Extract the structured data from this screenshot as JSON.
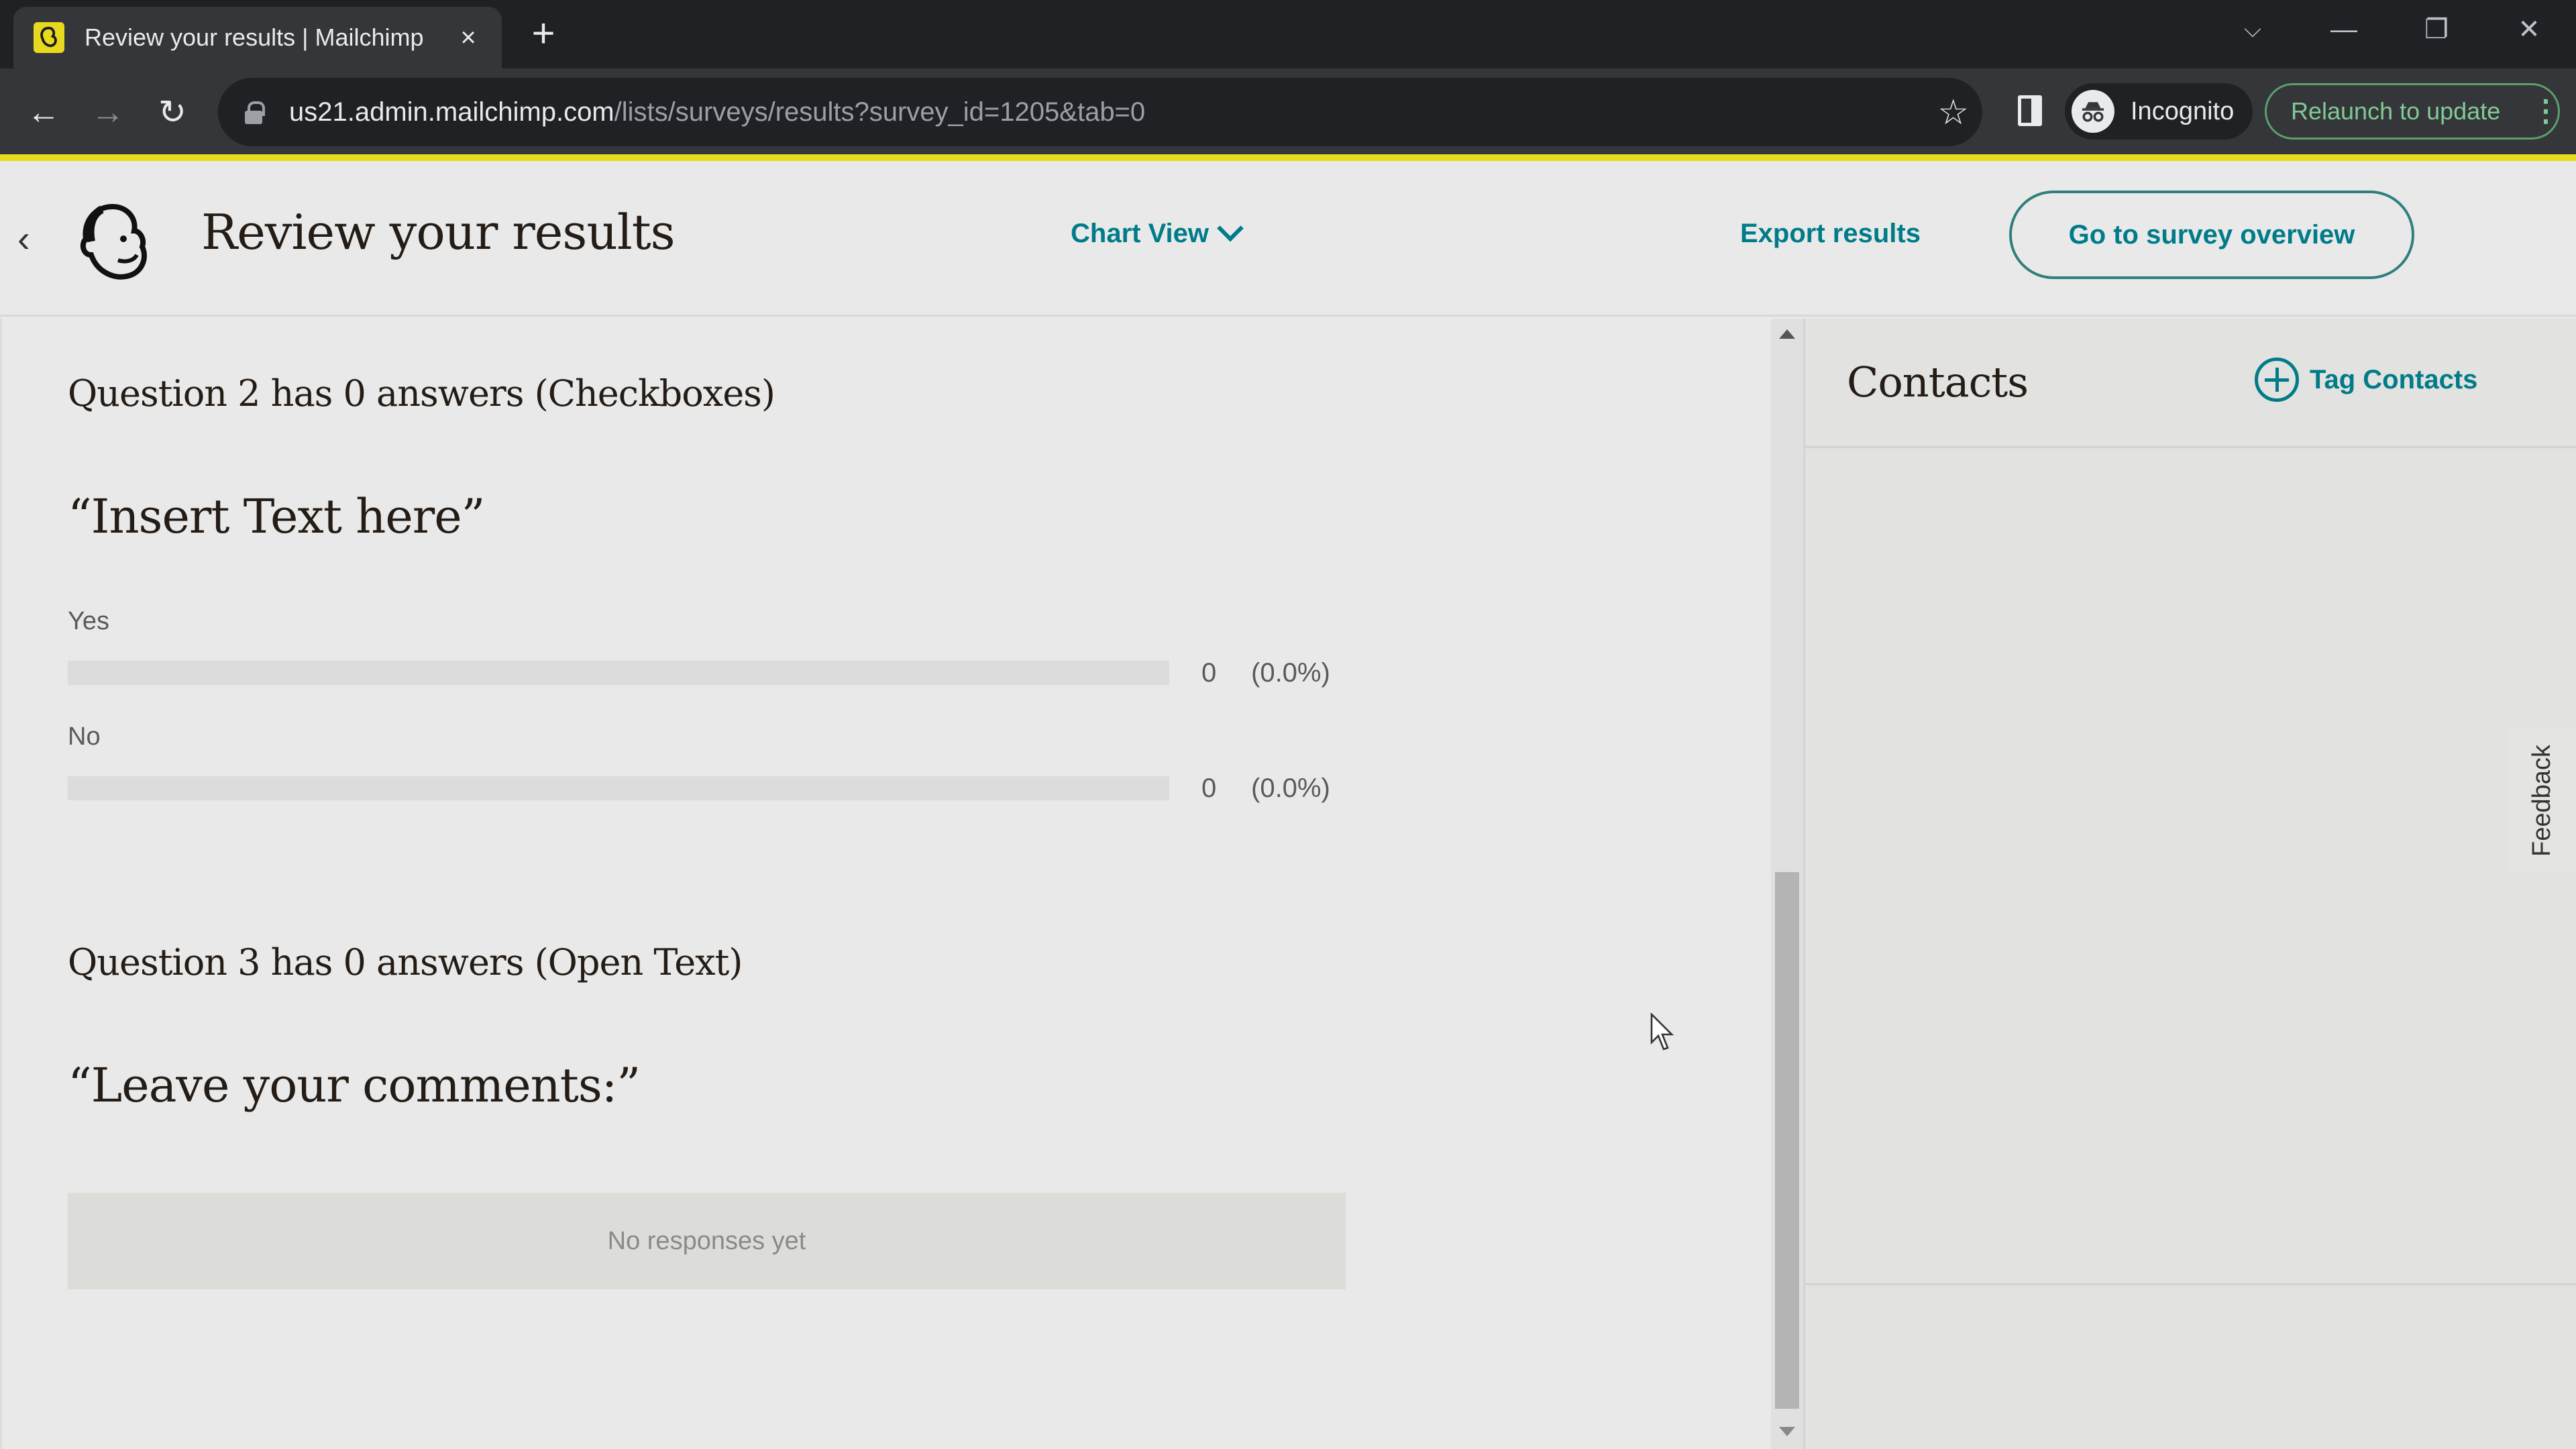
{
  "browser": {
    "tab_title": "Review your results | Mailchimp",
    "tab_close": "×",
    "new_tab": "+",
    "url_host": "us21.admin.mailchimp.com",
    "url_path": "/lists/surveys/results?survey_id=1205&tab=0",
    "profile_label": "Incognito",
    "relaunch_label": "Relaunch to update",
    "window_controls": {
      "tab_search": "⌵",
      "minimize": "—",
      "restore": "❐",
      "close": "✕"
    },
    "nav": {
      "back": "←",
      "forward": "→",
      "reload": "↻"
    },
    "star": "☆",
    "menu": "⋮"
  },
  "header": {
    "back": "‹",
    "title": "Review your results",
    "view_selector": "Chart View",
    "export_label": "Export results",
    "overview_button": "Go to survey overview"
  },
  "questions": [
    {
      "heading": "Question 2 has 0 answers (Checkboxes)",
      "text": "“Insert Text here”",
      "options": [
        {
          "label": "Yes",
          "count": "0",
          "percent": "(0.0%)",
          "fraction": 0.0
        },
        {
          "label": "No",
          "count": "0",
          "percent": "(0.0%)",
          "fraction": 0.0
        }
      ]
    },
    {
      "heading": "Question 3 has 0 answers (Open Text)",
      "text": "“Leave your comments:”",
      "empty_message": "No responses yet"
    }
  ],
  "contacts": {
    "title": "Contacts",
    "tag_button": "Tag Contacts"
  },
  "feedback_label": "Feedback",
  "colors": {
    "accent": "#007c89",
    "brand_yellow": "#e5dc1c",
    "text_dark": "#241c15"
  }
}
